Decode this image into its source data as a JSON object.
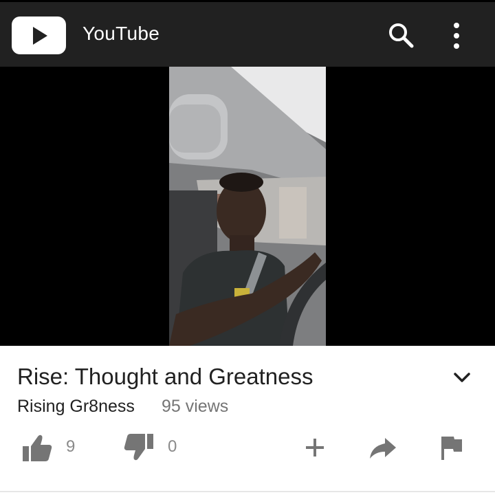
{
  "app": {
    "title": "YouTube",
    "logo_icon": "play-icon",
    "appbar_color": "#212121"
  },
  "toolbar": {
    "search_icon": "search-icon",
    "menu_icon": "more-vert-icon"
  },
  "video": {
    "title": "Rise: Thought and Greatness",
    "channel": "Rising Gr8ness",
    "views": "95 views",
    "expand_icon": "chevron-down-icon"
  },
  "actions": {
    "likes": "9",
    "dislikes": "0",
    "like_icon": "thumbs-up-icon",
    "dislike_icon": "thumbs-down-icon",
    "add_icon": "plus-icon",
    "share_icon": "share-icon",
    "flag_icon": "flag-icon",
    "icon_color": "#757575"
  }
}
